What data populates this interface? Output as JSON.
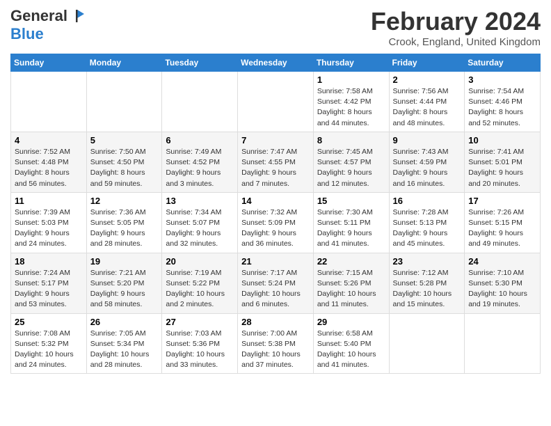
{
  "header": {
    "logo_general": "General",
    "logo_blue": "Blue",
    "title": "February 2024",
    "location": "Crook, England, United Kingdom"
  },
  "calendar": {
    "days_of_week": [
      "Sunday",
      "Monday",
      "Tuesday",
      "Wednesday",
      "Thursday",
      "Friday",
      "Saturday"
    ],
    "weeks": [
      [
        {
          "day": "",
          "info": ""
        },
        {
          "day": "",
          "info": ""
        },
        {
          "day": "",
          "info": ""
        },
        {
          "day": "",
          "info": ""
        },
        {
          "day": "1",
          "info": "Sunrise: 7:58 AM\nSunset: 4:42 PM\nDaylight: 8 hours\nand 44 minutes."
        },
        {
          "day": "2",
          "info": "Sunrise: 7:56 AM\nSunset: 4:44 PM\nDaylight: 8 hours\nand 48 minutes."
        },
        {
          "day": "3",
          "info": "Sunrise: 7:54 AM\nSunset: 4:46 PM\nDaylight: 8 hours\nand 52 minutes."
        }
      ],
      [
        {
          "day": "4",
          "info": "Sunrise: 7:52 AM\nSunset: 4:48 PM\nDaylight: 8 hours\nand 56 minutes."
        },
        {
          "day": "5",
          "info": "Sunrise: 7:50 AM\nSunset: 4:50 PM\nDaylight: 8 hours\nand 59 minutes."
        },
        {
          "day": "6",
          "info": "Sunrise: 7:49 AM\nSunset: 4:52 PM\nDaylight: 9 hours\nand 3 minutes."
        },
        {
          "day": "7",
          "info": "Sunrise: 7:47 AM\nSunset: 4:55 PM\nDaylight: 9 hours\nand 7 minutes."
        },
        {
          "day": "8",
          "info": "Sunrise: 7:45 AM\nSunset: 4:57 PM\nDaylight: 9 hours\nand 12 minutes."
        },
        {
          "day": "9",
          "info": "Sunrise: 7:43 AM\nSunset: 4:59 PM\nDaylight: 9 hours\nand 16 minutes."
        },
        {
          "day": "10",
          "info": "Sunrise: 7:41 AM\nSunset: 5:01 PM\nDaylight: 9 hours\nand 20 minutes."
        }
      ],
      [
        {
          "day": "11",
          "info": "Sunrise: 7:39 AM\nSunset: 5:03 PM\nDaylight: 9 hours\nand 24 minutes."
        },
        {
          "day": "12",
          "info": "Sunrise: 7:36 AM\nSunset: 5:05 PM\nDaylight: 9 hours\nand 28 minutes."
        },
        {
          "day": "13",
          "info": "Sunrise: 7:34 AM\nSunset: 5:07 PM\nDaylight: 9 hours\nand 32 minutes."
        },
        {
          "day": "14",
          "info": "Sunrise: 7:32 AM\nSunset: 5:09 PM\nDaylight: 9 hours\nand 36 minutes."
        },
        {
          "day": "15",
          "info": "Sunrise: 7:30 AM\nSunset: 5:11 PM\nDaylight: 9 hours\nand 41 minutes."
        },
        {
          "day": "16",
          "info": "Sunrise: 7:28 AM\nSunset: 5:13 PM\nDaylight: 9 hours\nand 45 minutes."
        },
        {
          "day": "17",
          "info": "Sunrise: 7:26 AM\nSunset: 5:15 PM\nDaylight: 9 hours\nand 49 minutes."
        }
      ],
      [
        {
          "day": "18",
          "info": "Sunrise: 7:24 AM\nSunset: 5:17 PM\nDaylight: 9 hours\nand 53 minutes."
        },
        {
          "day": "19",
          "info": "Sunrise: 7:21 AM\nSunset: 5:20 PM\nDaylight: 9 hours\nand 58 minutes."
        },
        {
          "day": "20",
          "info": "Sunrise: 7:19 AM\nSunset: 5:22 PM\nDaylight: 10 hours\nand 2 minutes."
        },
        {
          "day": "21",
          "info": "Sunrise: 7:17 AM\nSunset: 5:24 PM\nDaylight: 10 hours\nand 6 minutes."
        },
        {
          "day": "22",
          "info": "Sunrise: 7:15 AM\nSunset: 5:26 PM\nDaylight: 10 hours\nand 11 minutes."
        },
        {
          "day": "23",
          "info": "Sunrise: 7:12 AM\nSunset: 5:28 PM\nDaylight: 10 hours\nand 15 minutes."
        },
        {
          "day": "24",
          "info": "Sunrise: 7:10 AM\nSunset: 5:30 PM\nDaylight: 10 hours\nand 19 minutes."
        }
      ],
      [
        {
          "day": "25",
          "info": "Sunrise: 7:08 AM\nSunset: 5:32 PM\nDaylight: 10 hours\nand 24 minutes."
        },
        {
          "day": "26",
          "info": "Sunrise: 7:05 AM\nSunset: 5:34 PM\nDaylight: 10 hours\nand 28 minutes."
        },
        {
          "day": "27",
          "info": "Sunrise: 7:03 AM\nSunset: 5:36 PM\nDaylight: 10 hours\nand 33 minutes."
        },
        {
          "day": "28",
          "info": "Sunrise: 7:00 AM\nSunset: 5:38 PM\nDaylight: 10 hours\nand 37 minutes."
        },
        {
          "day": "29",
          "info": "Sunrise: 6:58 AM\nSunset: 5:40 PM\nDaylight: 10 hours\nand 41 minutes."
        },
        {
          "day": "",
          "info": ""
        },
        {
          "day": "",
          "info": ""
        }
      ]
    ]
  }
}
